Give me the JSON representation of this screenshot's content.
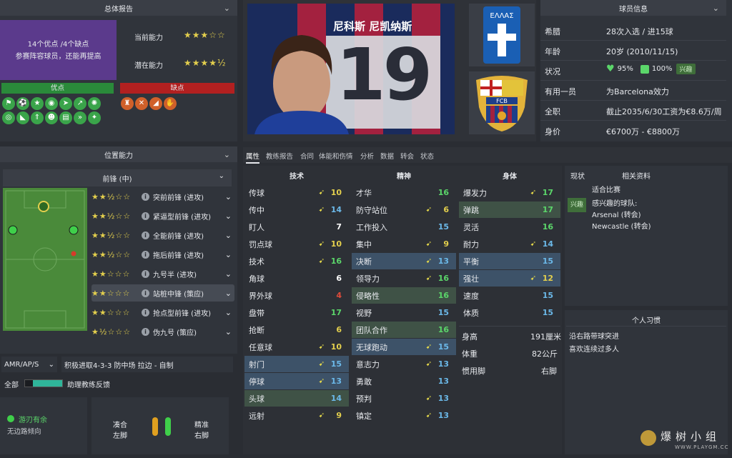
{
  "overview": {
    "header": "总体报告",
    "strengths_text": "14个优点 /4个缺点",
    "desc": "参赛阵容球员，还能再提高",
    "current_ability_label": "当前能力",
    "potential_ability_label": "潜在能力",
    "current_stars": "★★★☆☆",
    "potential_stars": "★★★★½",
    "strengths_label": "优点",
    "weaknesses_label": "缺点"
  },
  "player": {
    "name": "尼科斯 尼凯纳斯",
    "number": "19",
    "country_text": "ΕΛΛΑΣ",
    "club_text": "FCB"
  },
  "info": {
    "header": "球员信息",
    "rows": [
      {
        "label": "希腊",
        "value": "28次入选 / 进15球"
      },
      {
        "label": "年龄",
        "value": "20岁 (2010/11/15)"
      },
      {
        "label": "状况",
        "value": ""
      },
      {
        "label": "有用一员",
        "value": "为Barcelona效力"
      },
      {
        "label": "全职",
        "value": "截止2035/6/30工资为€8.6万/周"
      },
      {
        "label": "身价",
        "value": "€6700万 - €8800万"
      }
    ],
    "condition": "95%",
    "sharpness": "100%",
    "interest_badge": "兴趣"
  },
  "positions": {
    "header": "位置能力",
    "selected": "前锋 (中)",
    "roles": [
      {
        "stars": "★★½☆☆",
        "name": "突前前锋 (进攻)"
      },
      {
        "stars": "★★½☆☆",
        "name": "紧逼型前锋 (进攻)"
      },
      {
        "stars": "★★½☆☆",
        "name": "全能前锋 (进攻)"
      },
      {
        "stars": "★★½☆☆",
        "name": "拖后前锋 (进攻)"
      },
      {
        "stars": "★★☆☆☆",
        "name": "九号半 (进攻)"
      },
      {
        "stars": "★★☆☆☆",
        "name": "站桩中锋 (策应)"
      },
      {
        "stars": "★★☆☆☆",
        "name": "抢点型前锋 (进攻)"
      },
      {
        "stars": "★½☆☆☆",
        "name": "伪九号 (策应)"
      }
    ]
  },
  "tactics": {
    "role_code": "AMR/AP/S",
    "tactic": "积极进取4-3-3 防中场 拉边 - 自制",
    "scope": "全部",
    "assistant": "助理教练反馈"
  },
  "traits_box": {
    "trait": "游刃有余",
    "trait_sub": "无边路倾向",
    "foot_left_top": "凑合",
    "foot_left_bottom": "左脚",
    "foot_right_top": "精准",
    "foot_right_bottom": "右脚"
  },
  "tabs": [
    "属性",
    "教练报告",
    "合同",
    "体能和伤情",
    "分析",
    "数据",
    "转会",
    "状态"
  ],
  "attributes": {
    "tech_header": "技术",
    "mental_header": "精神",
    "physical_header": "身体",
    "technical": [
      {
        "name": "传球",
        "value": "10",
        "arrow": "➹"
      },
      {
        "name": "传中",
        "value": "14",
        "arrow": "➹"
      },
      {
        "name": "盯人",
        "value": "7",
        "arrow": ""
      },
      {
        "name": "罚点球",
        "value": "10",
        "arrow": "➹"
      },
      {
        "name": "技术",
        "value": "16",
        "arrow": "➹"
      },
      {
        "name": "角球",
        "value": "6",
        "arrow": ""
      },
      {
        "name": "界外球",
        "value": "4",
        "arrow": ""
      },
      {
        "name": "盘带",
        "value": "17",
        "arrow": ""
      },
      {
        "name": "抢断",
        "value": "6",
        "arrow": ""
      },
      {
        "name": "任意球",
        "value": "10",
        "arrow": "➹"
      },
      {
        "name": "射门",
        "value": "15",
        "arrow": "➹"
      },
      {
        "name": "停球",
        "value": "13",
        "arrow": "➹"
      },
      {
        "name": "头球",
        "value": "14",
        "arrow": ""
      },
      {
        "name": "远射",
        "value": "9",
        "arrow": "➹"
      }
    ],
    "mental": [
      {
        "name": "才华",
        "value": "16",
        "arrow": ""
      },
      {
        "name": "防守站位",
        "value": "6",
        "arrow": "➹"
      },
      {
        "name": "工作投入",
        "value": "15",
        "arrow": ""
      },
      {
        "name": "集中",
        "value": "9",
        "arrow": "➹"
      },
      {
        "name": "决断",
        "value": "13",
        "arrow": "➹"
      },
      {
        "name": "领导力",
        "value": "16",
        "arrow": "➹"
      },
      {
        "name": "侵略性",
        "value": "16",
        "arrow": ""
      },
      {
        "name": "视野",
        "value": "15",
        "arrow": ""
      },
      {
        "name": "团队合作",
        "value": "16",
        "arrow": ""
      },
      {
        "name": "无球跑动",
        "value": "15",
        "arrow": "➹"
      },
      {
        "name": "意志力",
        "value": "13",
        "arrow": "➹"
      },
      {
        "name": "勇敢",
        "value": "13",
        "arrow": ""
      },
      {
        "name": "预判",
        "value": "13",
        "arrow": "➹"
      },
      {
        "name": "镇定",
        "value": "13",
        "arrow": "➹"
      }
    ],
    "physical": [
      {
        "name": "爆发力",
        "value": "17",
        "arrow": "➹"
      },
      {
        "name": "弹跳",
        "value": "17",
        "arrow": ""
      },
      {
        "name": "灵活",
        "value": "16",
        "arrow": ""
      },
      {
        "name": "耐力",
        "value": "14",
        "arrow": "➹"
      },
      {
        "name": "平衡",
        "value": "15",
        "arrow": ""
      },
      {
        "name": "强壮",
        "value": "12",
        "arrow": "➹"
      },
      {
        "name": "速度",
        "value": "15",
        "arrow": ""
      },
      {
        "name": "体质",
        "value": "15",
        "arrow": ""
      }
    ],
    "height_label": "身高",
    "height": "191厘米",
    "weight_label": "体重",
    "weight": "82公斤",
    "foot_label": "惯用脚",
    "foot": "右脚"
  },
  "related": {
    "col1": "现状",
    "col2": "相关资料",
    "line1": "适合比赛",
    "badge": "兴趣",
    "line2": "感兴趣的球队:",
    "line3": "Arsenal (转会)",
    "line4": "Newcastle (转会)"
  },
  "habits": {
    "header": "个人习惯",
    "items": [
      "沿右路带球突进",
      "喜欢连续过多人"
    ]
  },
  "watermark": {
    "main": "爆树小组",
    "sub": "WWW.PLAYGM.CC"
  },
  "colors": {
    "green": "#5bd66a",
    "blue": "#6bb8e8",
    "yellow": "#e3cf4d",
    "red": "#e04b3a",
    "purple": "#5b3a8c"
  }
}
